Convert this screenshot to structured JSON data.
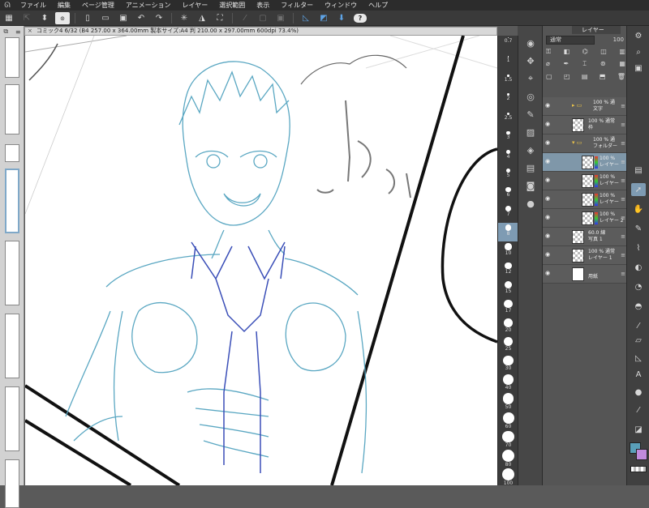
{
  "menubar": {
    "items": [
      "ファイル",
      "編集",
      "ページ管理",
      "アニメーション",
      "レイヤー",
      "選択範囲",
      "表示",
      "フィルター",
      "ウィンドウ",
      "ヘルプ"
    ]
  },
  "toolbar": {
    "icons": [
      "selection-arrow-icon",
      "stepper-icon",
      "swirl-icon",
      "new-file-icon",
      "open-file-icon",
      "save-icon",
      "undo-icon",
      "redo-icon",
      "loading-icon",
      "eraser-icon",
      "transform-icon",
      "dim-tool-icon",
      "dim-tool-icon-2",
      "dim-tool-icon-3",
      "ruler-snap-icon",
      "special-ruler-icon",
      "grid-snap-icon",
      "help-icon"
    ],
    "help_label": "?"
  },
  "document": {
    "tab_title": "コミック4 6/32 (B4 257.00 x 364.00mm 製本サイズ:A4 判 210.00 x 297.00mm 600dpi 73.4%)",
    "close_glyph": "×"
  },
  "brush_sizes": [
    "0.7",
    "1",
    "1.5",
    "2",
    "2.5",
    "3",
    "4",
    "5",
    "6",
    "7",
    "8",
    "10",
    "12",
    "15",
    "17",
    "20",
    "25",
    "30",
    "40",
    "50",
    "60",
    "70",
    "80",
    "100"
  ],
  "brush_size_selected": "8",
  "layer_panel": {
    "tab_label": "レイヤー",
    "blend_mode": "通常",
    "opacity": "100",
    "layers": [
      {
        "line1": "100 % 通",
        "line2": "文字",
        "kind": "folder-collapsed"
      },
      {
        "line1": "100 % 通常",
        "line2": "枠",
        "kind": "layer"
      },
      {
        "line1": "100 % 通",
        "line2": "フォルダー",
        "kind": "folder-open"
      },
      {
        "line1": "100 %",
        "line2": "レイヤー",
        "kind": "sub",
        "selected": true
      },
      {
        "line1": "100 %",
        "line2": "レイヤー",
        "kind": "sub"
      },
      {
        "line1": "100 %",
        "line2": "レイヤー",
        "kind": "sub"
      },
      {
        "line1": "100 %",
        "line2": "レイヤー 2",
        "kind": "sub"
      },
      {
        "line1": "60.0 線",
        "line2": "写真 1",
        "kind": "layer"
      },
      {
        "line1": "100 % 通常",
        "line2": "レイヤー 1",
        "kind": "layer"
      },
      {
        "line1": "",
        "line2": "用紙",
        "kind": "paper"
      }
    ]
  },
  "colors": {
    "main": "#5a9fb8",
    "sub": "#c08adb",
    "sketch_light": "#5aa7c2",
    "sketch_dark": "#3b4fb8"
  }
}
